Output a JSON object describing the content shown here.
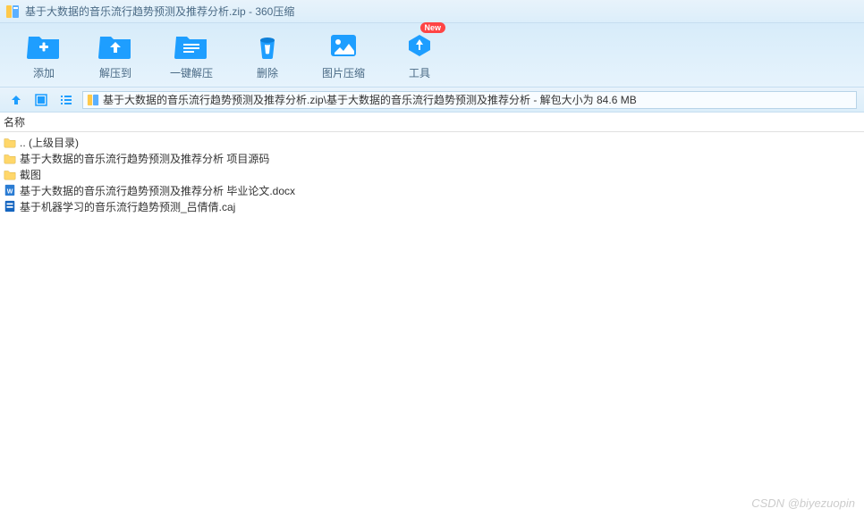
{
  "window": {
    "title": "基于大数据的音乐流行趋势预测及推荐分析.zip - 360压缩"
  },
  "toolbar": {
    "add": "添加",
    "extract_to": "解压到",
    "one_click_extract": "一键解压",
    "delete": "删除",
    "image_compress": "图片压缩",
    "tools": "工具",
    "new_badge": "New"
  },
  "path": {
    "text": "基于大数据的音乐流行趋势预测及推荐分析.zip\\基于大数据的音乐流行趋势预测及推荐分析 - 解包大小为 84.6 MB"
  },
  "columns": {
    "name": "名称"
  },
  "files": [
    {
      "name": ".. (上级目录)",
      "type": "folder"
    },
    {
      "name": "基于大数据的音乐流行趋势预测及推荐分析 项目源码",
      "type": "folder"
    },
    {
      "name": "截图",
      "type": "folder"
    },
    {
      "name": "基于大数据的音乐流行趋势预测及推荐分析 毕业论文.docx",
      "type": "docx"
    },
    {
      "name": "基于机器学习的音乐流行趋势预测_吕倩倩.caj",
      "type": "caj"
    }
  ],
  "watermark": "CSDN @biyezuopin",
  "colors": {
    "icon_blue": "#1e9eff",
    "folder": "#ffd76a"
  }
}
